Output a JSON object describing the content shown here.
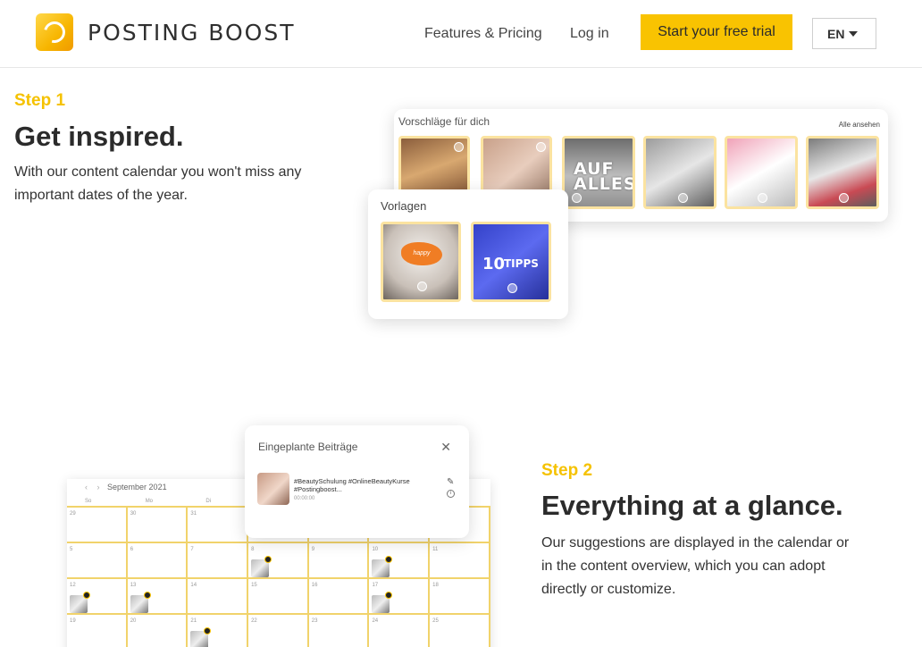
{
  "header": {
    "logo_text": "POSTING BOOST",
    "nav": {
      "features": "Features & Pricing",
      "login": "Log in"
    },
    "cta": "Start your free trial",
    "language": "EN"
  },
  "step1": {
    "label": "Step 1",
    "title": "Get inspired.",
    "description": "With our content calendar you won't miss any important dates of the year.",
    "suggestions_card": {
      "title": "Vorschläge für dich",
      "see_all": "Alle ansehen",
      "thumb3_overlay": "AUF ALLES"
    },
    "templates_card": {
      "title": "Vorlagen",
      "template2_number": "10",
      "template2_text": "TIPPS"
    }
  },
  "step2": {
    "label": "Step 2",
    "title": "Everything at a glance.",
    "description": "Our suggestions are displayed in the calendar or in the content overview, which you can adopt directly or customize.",
    "calendar": {
      "month": "September 2021",
      "days_of_week": [
        "So",
        "Mo",
        "Di",
        "",
        "",
        "",
        ""
      ],
      "rows": [
        [
          "29",
          "30",
          "31",
          "",
          "",
          "",
          ""
        ],
        [
          "5",
          "6",
          "7",
          "8",
          "9",
          "10",
          "11"
        ],
        [
          "12",
          "13",
          "14",
          "15",
          "16",
          "17",
          "18"
        ],
        [
          "19",
          "20",
          "21",
          "22",
          "23",
          "24",
          "25"
        ]
      ]
    },
    "popup": {
      "title": "Eingeplante Beiträge",
      "post_text": "#BeautySchulung #OnlineBeautyKurse #Postingboost...",
      "post_time": "00:00:00"
    }
  },
  "colors": {
    "accent": "#f9c301",
    "step_label": "#f5c200",
    "thumb_border": "#fbe3a0"
  }
}
